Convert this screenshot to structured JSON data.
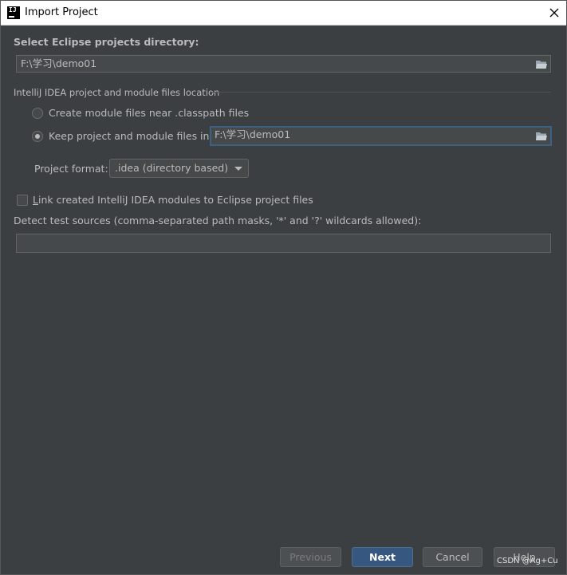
{
  "window": {
    "title": "Import Project",
    "app_icon_text": "IJ"
  },
  "eclipse_dir": {
    "label": "Select Eclipse projects directory:",
    "value": "F:\\学习\\demo01"
  },
  "location": {
    "section_label": "IntelliJ IDEA project and module files location",
    "option_near_classpath": "Create module files near .classpath files",
    "option_keep_in": "Keep project and module files in",
    "keep_in_path": "F:\\学习\\demo01",
    "selected_option": "keep_in"
  },
  "project_format": {
    "label": "Project format:",
    "selected": ".idea (directory based)"
  },
  "link_modules": {
    "label_first_char": "L",
    "label_rest": "ink created IntelliJ IDEA modules to Eclipse project files",
    "checked": false
  },
  "test_sources": {
    "label": "Detect test sources (comma-separated path masks, '*' and '?' wildcards allowed):",
    "value": ""
  },
  "buttons": {
    "previous": "Previous",
    "next": "Next",
    "cancel": "Cancel",
    "help": "Help"
  },
  "watermark": "CSDN @Ag+Cu",
  "colors": {
    "background": "#3c3f41",
    "text": "#bbbbbb",
    "primary_button": "#365880",
    "focus_border": "#3d6185"
  }
}
